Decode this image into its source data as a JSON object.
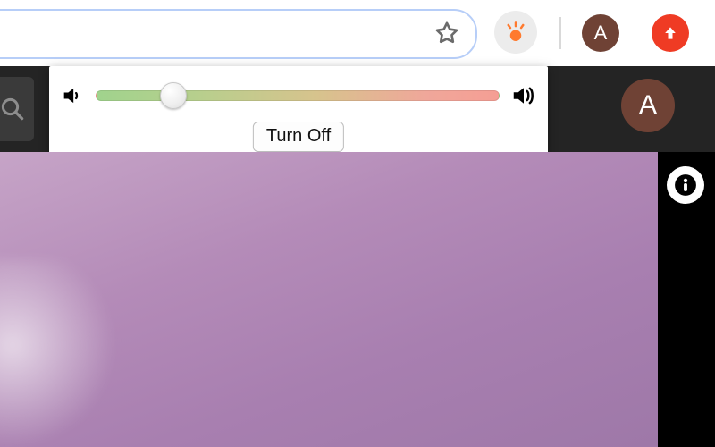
{
  "browser": {
    "omnibox_value": "",
    "profile_initial": "A"
  },
  "extension_popup": {
    "slider_percent": 19,
    "turn_off_label": "Turn Off"
  },
  "site_header": {
    "profile_initial": "A"
  },
  "colors": {
    "brand_orange": "#ff7a2e",
    "alert_red": "#ef3b24",
    "avatar_brown": "#6f4235"
  },
  "icons": {
    "star": "star-outline",
    "extension": "fan-orange",
    "upload": "arrow-up",
    "search": "magnifier",
    "volume_low": "speaker-low",
    "volume_high": "speaker-high",
    "info": "info"
  }
}
